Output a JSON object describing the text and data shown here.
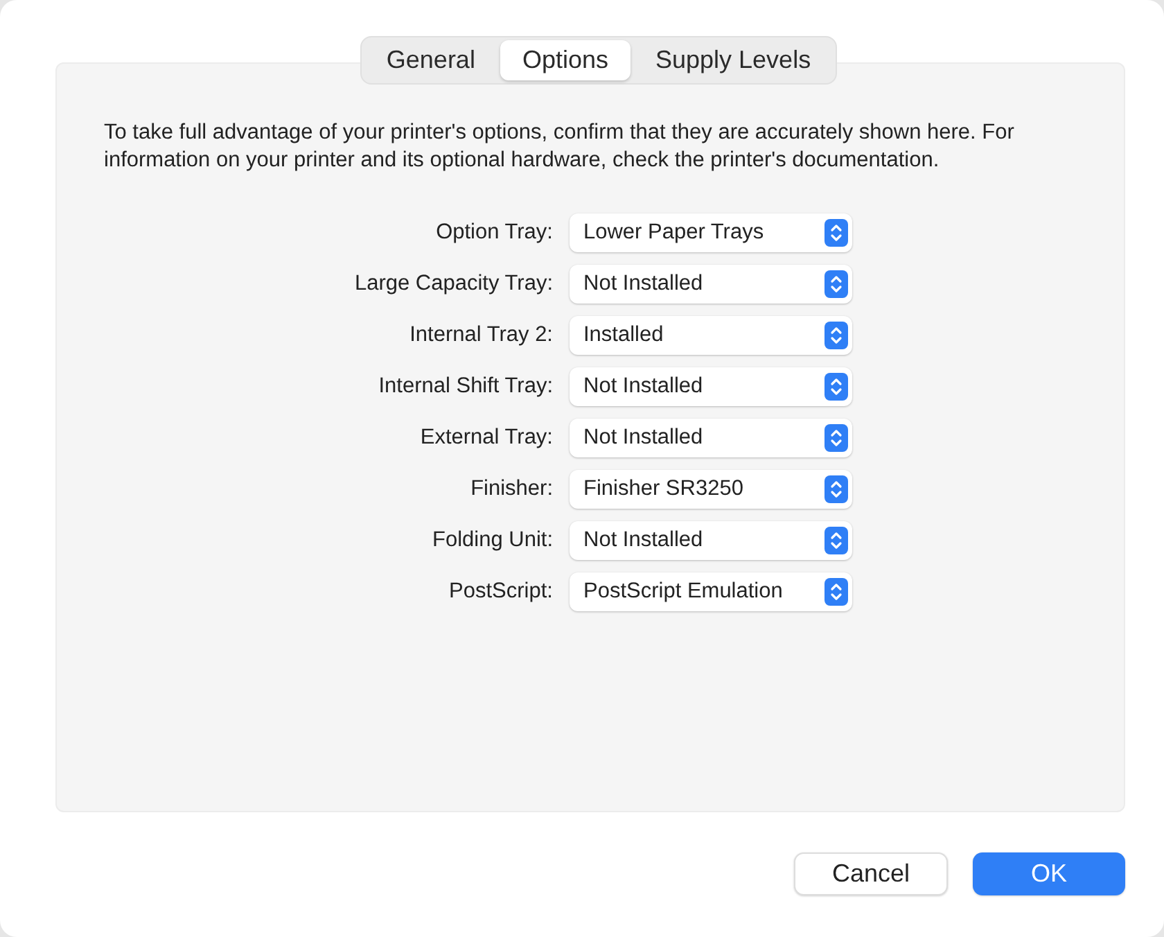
{
  "tabs": [
    {
      "label": "General",
      "selected": false
    },
    {
      "label": "Options",
      "selected": true
    },
    {
      "label": "Supply Levels",
      "selected": false
    }
  ],
  "intro": "To take full advantage of your printer's options, confirm that they are accurately shown here. For information on your printer and its optional hardware, check the printer's documentation.",
  "options": [
    {
      "label": "Option Tray:",
      "value": "Lower Paper Trays"
    },
    {
      "label": "Large Capacity Tray:",
      "value": "Not Installed"
    },
    {
      "label": "Internal Tray 2:",
      "value": "Installed"
    },
    {
      "label": "Internal Shift Tray:",
      "value": "Not Installed"
    },
    {
      "label": "External Tray:",
      "value": "Not Installed"
    },
    {
      "label": "Finisher:",
      "value": "Finisher SR3250"
    },
    {
      "label": "Folding Unit:",
      "value": "Not Installed"
    },
    {
      "label": "PostScript:",
      "value": "PostScript Emulation"
    }
  ],
  "buttons": [
    {
      "label": "Cancel",
      "kind": "secondary"
    },
    {
      "label": "OK",
      "kind": "primary"
    }
  ]
}
